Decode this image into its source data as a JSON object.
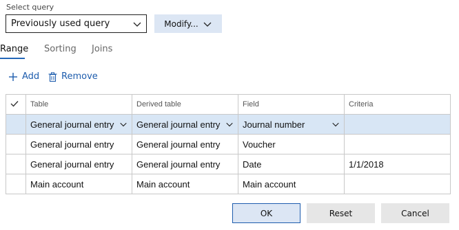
{
  "query": {
    "label": "Select query",
    "selected": "Previously used query",
    "modify_label": "Modify..."
  },
  "tabs": [
    {
      "label": "Range",
      "active": true
    },
    {
      "label": "Sorting",
      "active": false
    },
    {
      "label": "Joins",
      "active": false
    }
  ],
  "toolbar": {
    "add_label": "Add",
    "remove_label": "Remove"
  },
  "grid": {
    "columns": [
      "Table",
      "Derived table",
      "Field",
      "Criteria"
    ],
    "rows": [
      {
        "table": "General journal entry",
        "derived": "General journal entry",
        "field": "Journal number",
        "criteria": "",
        "selected": true
      },
      {
        "table": "General journal entry",
        "derived": "General journal entry",
        "field": "Voucher",
        "criteria": "",
        "selected": false
      },
      {
        "table": "General journal entry",
        "derived": "General journal entry",
        "field": "Date",
        "criteria": "1/1/2018",
        "selected": false
      },
      {
        "table": "Main account",
        "derived": "Main account",
        "field": "Main account",
        "criteria": "",
        "selected": false
      }
    ]
  },
  "footer": {
    "ok_label": "OK",
    "reset_label": "Reset",
    "cancel_label": "Cancel"
  },
  "colors": {
    "accent": "#1d5cad",
    "selected_row": "#d8e6f5",
    "primary_button": "#dce6f4"
  }
}
